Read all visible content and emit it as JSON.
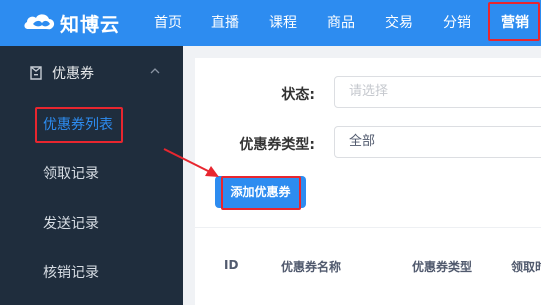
{
  "brand": {
    "name": "知博云"
  },
  "nav": {
    "items": [
      "首页",
      "直播",
      "课程",
      "商品",
      "交易",
      "分销",
      "营销"
    ],
    "active": "营销"
  },
  "sidebar": {
    "group_label": "优惠券",
    "items": [
      "优惠券列表",
      "领取记录",
      "发送记录",
      "核销记录"
    ],
    "active": "优惠券列表"
  },
  "filters": {
    "status_label": "状态:",
    "status_placeholder": "请选择",
    "type_label": "优惠券类型:",
    "type_value": "全部"
  },
  "actions": {
    "add_coupon": "添加优惠券"
  },
  "table": {
    "columns": [
      "ID",
      "优惠券名称",
      "优惠券类型",
      "领取时"
    ]
  },
  "colors": {
    "primary": "#2d8cf0",
    "sidebar_bg": "#1f2d3d",
    "highlight": "#e8262f"
  }
}
